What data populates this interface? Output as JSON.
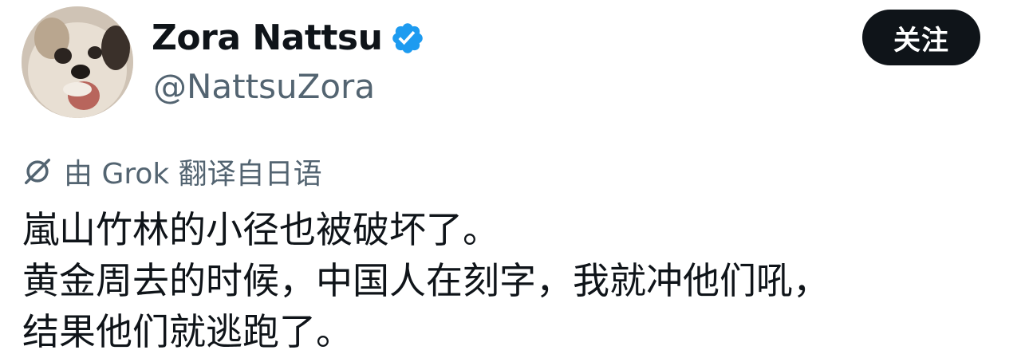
{
  "profile": {
    "display_name": "Zora Nattsu",
    "handle": "@NattsuZora",
    "verified": true,
    "verified_color": "#1d9bf0",
    "avatar": "dog-photo-avatar"
  },
  "follow_button": {
    "label": "关注",
    "bg_color": "#0f1419",
    "text_color": "#ffffff"
  },
  "translation": {
    "icon": "grok-icon",
    "label": "由 Grok 翻译自日语"
  },
  "tweet": {
    "lines": [
      "嵐山竹林的小径也被破坏了。",
      "黄金周去的时候，中国人在刻字，我就冲他们吼，",
      "结果他们就逃跑了。"
    ]
  },
  "colors": {
    "text_primary": "#0f1419",
    "text_secondary": "#536471",
    "background": "#ffffff"
  }
}
